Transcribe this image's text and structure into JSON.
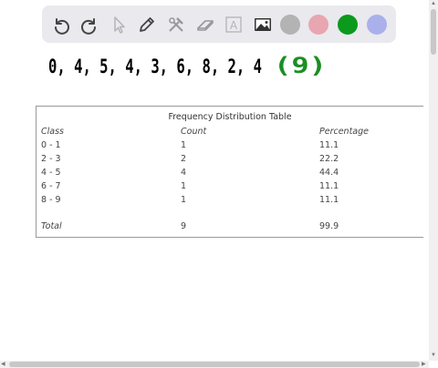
{
  "toolbar": {
    "tools": [
      {
        "icon": "undo-icon"
      },
      {
        "icon": "redo-icon"
      },
      {
        "icon": "select-cursor-icon"
      },
      {
        "icon": "pencil-icon"
      },
      {
        "icon": "tools-icon"
      },
      {
        "icon": "eraser-icon"
      },
      {
        "icon": "text-icon",
        "glyph": "A"
      },
      {
        "icon": "image-icon"
      }
    ],
    "colors": [
      "#b3b3b3",
      "#e8a6b1",
      "#0b9a1c",
      "#aab0ea"
    ]
  },
  "handwriting": {
    "data_text": "0, 4, 5, 4, 3, 6, 8, 2, 4",
    "count_text": "(9)",
    "data_color": "#000000",
    "count_color": "#1a8f23"
  },
  "table": {
    "title": "Frequency Distribution Table",
    "headers": [
      "Class",
      "Count",
      "Percentage"
    ],
    "rows": [
      [
        "0 - 1",
        "1",
        "11.1"
      ],
      [
        "2 - 3",
        "2",
        "22.2"
      ],
      [
        "4 - 5",
        "4",
        "44.4"
      ],
      [
        "6 - 7",
        "1",
        "11.1"
      ],
      [
        "8 - 9",
        "1",
        "11.1"
      ]
    ],
    "total": [
      "Total",
      "9",
      "99.9"
    ]
  }
}
